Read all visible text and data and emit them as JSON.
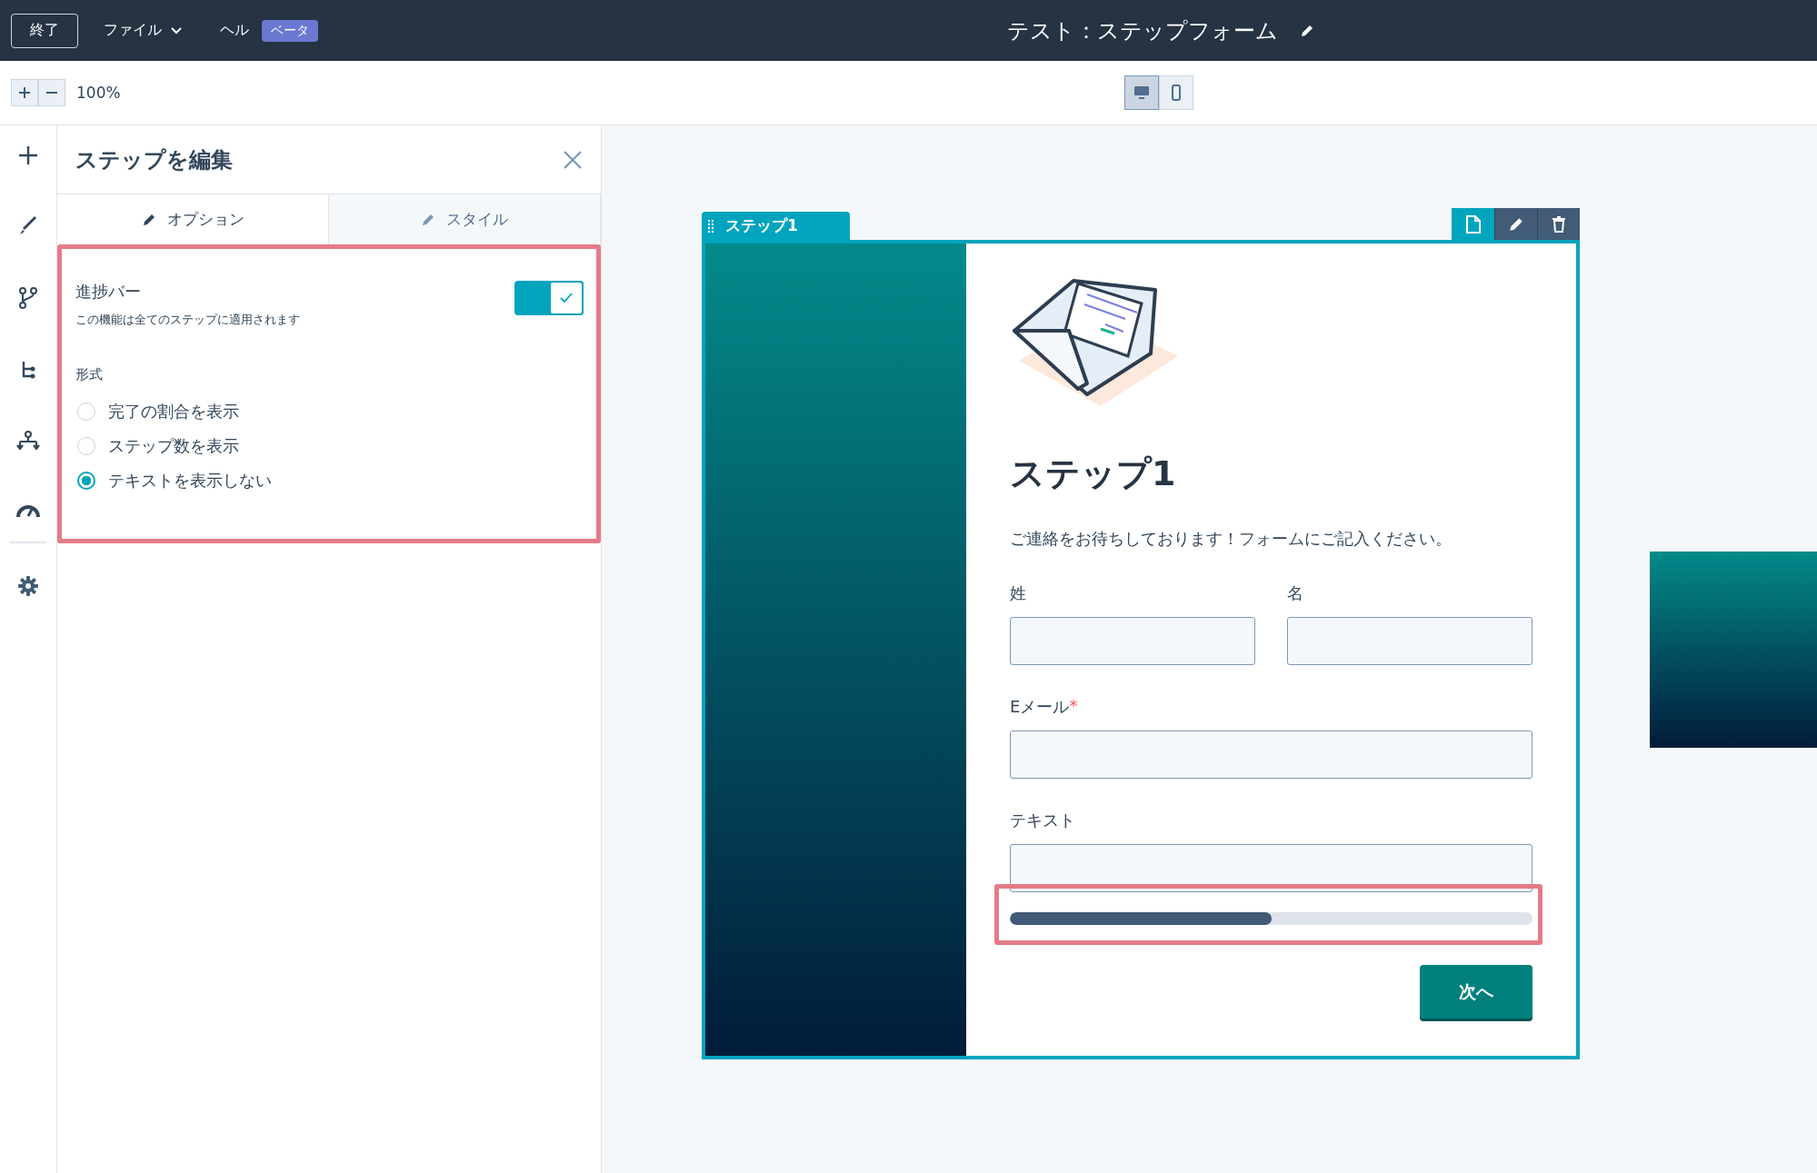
{
  "top_bar": {
    "exit_button": "終了",
    "menus": [
      {
        "label": "ファイル",
        "dropdown": true
      },
      {
        "label": "ヘル",
        "dropdown": false
      }
    ],
    "beta_badge": "ベータ",
    "title": "テスト：ステップフォーム"
  },
  "toolbar": {
    "zoom": "100%",
    "views": [
      {
        "kind": "desktop",
        "selected": true
      },
      {
        "kind": "mobile",
        "selected": false
      }
    ]
  },
  "panel": {
    "title": "ステップを編集",
    "tabs": [
      {
        "label": "オプション",
        "selected": true
      },
      {
        "label": "スタイル",
        "selected": false
      }
    ],
    "progress_setting": {
      "label": "進捗バー",
      "description": "この機能は全てのステップに適用されます",
      "on": true
    },
    "format": {
      "label": "形式",
      "options": [
        {
          "label": "完了の割合を表示",
          "selected": false
        },
        {
          "label": "ステップ数を表示",
          "selected": false
        },
        {
          "label": "テキストを表示しない",
          "selected": true
        }
      ]
    }
  },
  "form": {
    "step_tab": "ステップ1",
    "heading": "ステップ1",
    "intro": "ご連絡をお待ちしております！フォームにご記入ください。",
    "required_mark": "*",
    "fields": [
      {
        "label": "姓",
        "kind": "half",
        "required": false
      },
      {
        "label": "名",
        "kind": "half",
        "required": false
      },
      {
        "label": "Eメール",
        "kind": "full",
        "required": true
      },
      {
        "label": "テキスト",
        "kind": "full",
        "required": false
      }
    ],
    "progress": {
      "level": 0.5
    },
    "next_button": "次へ"
  }
}
